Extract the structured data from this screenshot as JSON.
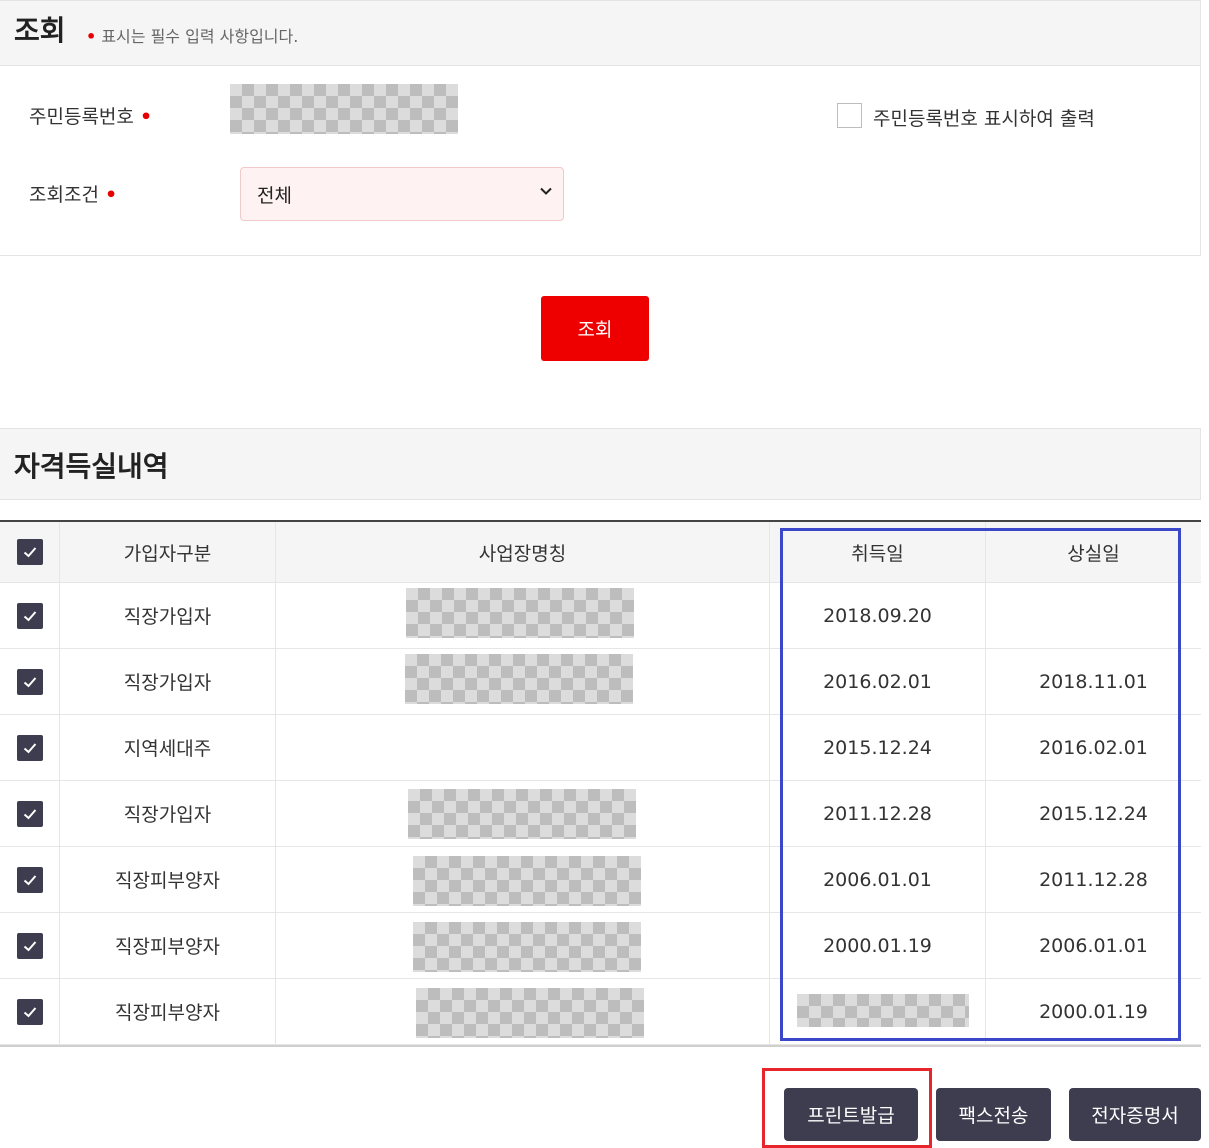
{
  "search": {
    "title": "조회",
    "required_note": "표시는 필수 입력 사항입니다.",
    "ssn_label": "주민등록번호",
    "ssn_print_label": "주민등록번호 표시하여 출력",
    "condition_label": "조회조건",
    "condition_value": "전체",
    "search_button": "조회"
  },
  "history": {
    "title": "자격득실내역",
    "columns": [
      "가입자구분",
      "사업장명칭",
      "취득일",
      "상실일"
    ],
    "rows": [
      {
        "type": "직장가입자",
        "acquired": "2018.09.20",
        "lost": ""
      },
      {
        "type": "직장가입자",
        "acquired": "2016.02.01",
        "lost": "2018.11.01"
      },
      {
        "type": "지역세대주",
        "acquired": "2015.12.24",
        "lost": "2016.02.01"
      },
      {
        "type": "직장가입자",
        "acquired": "2011.12.28",
        "lost": "2015.12.24"
      },
      {
        "type": "직장피부양자",
        "acquired": "2006.01.01",
        "lost": "2011.12.28"
      },
      {
        "type": "직장피부양자",
        "acquired": "2000.01.19",
        "lost": "2006.01.01"
      },
      {
        "type": "직장피부양자",
        "acquired": "",
        "lost": "2000.01.19"
      }
    ]
  },
  "actions": {
    "print": "프린트발급",
    "fax": "팩스전송",
    "e_cert": "전자증명서"
  },
  "colors": {
    "accent_red": "#ee0000",
    "dark_button": "#3d3d4f",
    "highlight_blue": "#3a47c8",
    "highlight_red": "#e6262b"
  }
}
